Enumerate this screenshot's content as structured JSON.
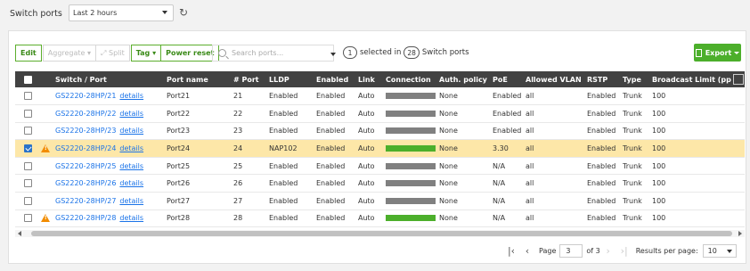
{
  "topbar": {
    "label": "Switch ports",
    "time_range": "Last 2 hours"
  },
  "toolbar": {
    "edit": "Edit",
    "aggregate": "Aggregate",
    "split": "Split",
    "tag": "Tag",
    "power_reset": "Power reset",
    "search_placeholder": "Search ports...",
    "selected_count": "1",
    "selected_in": "selected in",
    "total_count": "28",
    "total_label": "Switch ports",
    "export": "Export"
  },
  "table": {
    "columns": [
      "Switch / Port",
      "Port name",
      "# Port",
      "LLDP",
      "Enabled",
      "Link",
      "Connection",
      "Auth. policy",
      "PoE",
      "Allowed VLAN",
      "RSTP",
      "Type",
      "Broadcast Limit (pp"
    ],
    "details_label": "details",
    "rows": [
      {
        "switch": "GS2220-28HP/21",
        "port_name": "Port21",
        "port": "21",
        "lldp": "Enabled",
        "enabled": "Enabled",
        "link": "Auto",
        "connection": "gray",
        "auth": "None",
        "poe": "Enabled",
        "vlan": "all",
        "rstp": "Enabled",
        "type": "Trunk",
        "bcast": "100",
        "checked": false,
        "warn": false
      },
      {
        "switch": "GS2220-28HP/22",
        "port_name": "Port22",
        "port": "22",
        "lldp": "Enabled",
        "enabled": "Enabled",
        "link": "Auto",
        "connection": "gray",
        "auth": "None",
        "poe": "Enabled",
        "vlan": "all",
        "rstp": "Enabled",
        "type": "Trunk",
        "bcast": "100",
        "checked": false,
        "warn": false
      },
      {
        "switch": "GS2220-28HP/23",
        "port_name": "Port23",
        "port": "23",
        "lldp": "Enabled",
        "enabled": "Enabled",
        "link": "Auto",
        "connection": "gray",
        "auth": "None",
        "poe": "Enabled",
        "vlan": "all",
        "rstp": "Enabled",
        "type": "Trunk",
        "bcast": "100",
        "checked": false,
        "warn": false
      },
      {
        "switch": "GS2220-28HP/24",
        "port_name": "Port24",
        "port": "24",
        "lldp": "NAP102",
        "enabled": "Enabled",
        "link": "Auto",
        "connection": "green",
        "auth": "None",
        "poe": "3.30",
        "vlan": "all",
        "rstp": "Enabled",
        "type": "Trunk",
        "bcast": "100",
        "checked": true,
        "warn": true
      },
      {
        "switch": "GS2220-28HP/25",
        "port_name": "Port25",
        "port": "25",
        "lldp": "Enabled",
        "enabled": "Enabled",
        "link": "Auto",
        "connection": "gray",
        "auth": "None",
        "poe": "N/A",
        "vlan": "all",
        "rstp": "Enabled",
        "type": "Trunk",
        "bcast": "100",
        "checked": false,
        "warn": false
      },
      {
        "switch": "GS2220-28HP/26",
        "port_name": "Port26",
        "port": "26",
        "lldp": "Enabled",
        "enabled": "Enabled",
        "link": "Auto",
        "connection": "gray",
        "auth": "None",
        "poe": "N/A",
        "vlan": "all",
        "rstp": "Enabled",
        "type": "Trunk",
        "bcast": "100",
        "checked": false,
        "warn": false
      },
      {
        "switch": "GS2220-28HP/27",
        "port_name": "Port27",
        "port": "27",
        "lldp": "Enabled",
        "enabled": "Enabled",
        "link": "Auto",
        "connection": "gray",
        "auth": "None",
        "poe": "N/A",
        "vlan": "all",
        "rstp": "Enabled",
        "type": "Trunk",
        "bcast": "100",
        "checked": false,
        "warn": false
      },
      {
        "switch": "GS2220-28HP/28",
        "port_name": "Port28",
        "port": "28",
        "lldp": "Enabled",
        "enabled": "Enabled",
        "link": "Auto",
        "connection": "green",
        "auth": "None",
        "poe": "N/A",
        "vlan": "all",
        "rstp": "Enabled",
        "type": "Trunk",
        "bcast": "100",
        "checked": false,
        "warn": true
      }
    ]
  },
  "colors": {
    "connection_gray": "#808080",
    "connection_green": "#4caf2b",
    "selected_row": "#fde7a8",
    "warning": "#f28c00",
    "link": "#1a73e8"
  },
  "pager": {
    "page_label": "Page",
    "page_value": "3",
    "of_label": "of 3",
    "rpp_label": "Results per page:",
    "rpp_value": "10"
  }
}
